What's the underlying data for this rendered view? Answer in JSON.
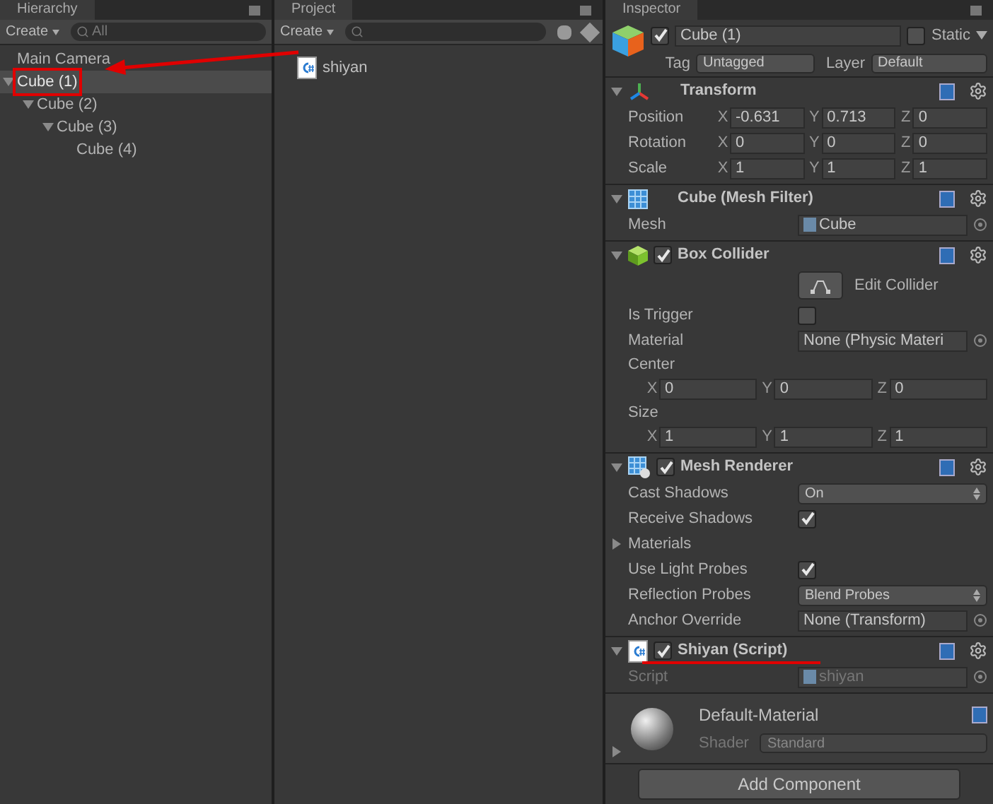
{
  "hierarchy": {
    "tab": "Hierarchy",
    "create": "Create",
    "search_placeholder": "All",
    "items": [
      {
        "label": "Main Camera",
        "selected": false
      },
      {
        "label": "Cube (1)",
        "selected": true,
        "marked": true,
        "expanded": true,
        "children": [
          {
            "label": "Cube (2)",
            "selected": false,
            "expanded": true,
            "children": [
              {
                "label": "Cube (3)",
                "selected": false,
                "expanded": true,
                "children": [
                  {
                    "label": "Cube (4)",
                    "selected": false
                  }
                ]
              }
            ]
          }
        ]
      }
    ]
  },
  "project": {
    "tab": "Project",
    "create": "Create",
    "assets": [
      {
        "name": "shiyan"
      }
    ]
  },
  "inspector": {
    "tab": "Inspector",
    "object": {
      "name": "Cube (1)",
      "active": true,
      "static_label": "Static",
      "static": false,
      "tag_label": "Tag",
      "tag": "Untagged",
      "layer_label": "Layer",
      "layer": "Default"
    },
    "components": [
      {
        "title": "Transform",
        "kind": "transform",
        "rows": [
          {
            "kind": "vector",
            "label": "Position",
            "axes": [
              {
                "axis": "X",
                "value": "-0.631"
              },
              {
                "axis": "Y",
                "value": "0.713"
              },
              {
                "axis": "Z",
                "value": "0"
              }
            ]
          },
          {
            "kind": "vector",
            "label": "Rotation",
            "axes": [
              {
                "axis": "X",
                "value": "0"
              },
              {
                "axis": "Y",
                "value": "0"
              },
              {
                "axis": "Z",
                "value": "0"
              }
            ]
          },
          {
            "kind": "vector",
            "label": "Scale",
            "axes": [
              {
                "axis": "X",
                "value": "1"
              },
              {
                "axis": "Y",
                "value": "1"
              },
              {
                "axis": "Z",
                "value": "1"
              }
            ]
          }
        ]
      },
      {
        "title": "Cube (Mesh Filter)",
        "kind": "mesh_filter",
        "rows": [
          {
            "kind": "object",
            "label": "Mesh",
            "value": "Cube",
            "disabled": false,
            "asset_icon": true
          }
        ]
      },
      {
        "title": "Box Collider",
        "kind": "collider",
        "enabled": true,
        "rows": [
          {
            "kind": "button",
            "label": "Edit Collider"
          },
          {
            "kind": "check",
            "label": "Is Trigger",
            "checked": false
          },
          {
            "kind": "object",
            "label": "Material",
            "value": "None (Physic Materi",
            "disabled": false
          },
          {
            "kind": "vector_block",
            "label": "Center",
            "axes": [
              {
                "axis": "X",
                "value": "0"
              },
              {
                "axis": "Y",
                "value": "0"
              },
              {
                "axis": "Z",
                "value": "0"
              }
            ]
          },
          {
            "kind": "vector_block",
            "label": "Size",
            "axes": [
              {
                "axis": "X",
                "value": "1"
              },
              {
                "axis": "Y",
                "value": "1"
              },
              {
                "axis": "Z",
                "value": "1"
              }
            ]
          }
        ]
      },
      {
        "title": "Mesh Renderer",
        "kind": "renderer",
        "enabled": true,
        "rows": [
          {
            "kind": "dropdown",
            "label": "Cast Shadows",
            "value": "On"
          },
          {
            "kind": "check",
            "label": "Receive Shadows",
            "checked": true
          },
          {
            "kind": "foldout",
            "label": "Materials",
            "expanded": false
          },
          {
            "kind": "check",
            "label": "Use Light Probes",
            "checked": true
          },
          {
            "kind": "dropdown",
            "label": "Reflection Probes",
            "value": "Blend Probes"
          },
          {
            "kind": "object",
            "label": "Anchor Override",
            "value": "None (Transform)",
            "disabled": false
          }
        ]
      },
      {
        "title": "Shiyan (Script)",
        "kind": "script",
        "enabled": true,
        "marked": true,
        "rows": [
          {
            "kind": "object",
            "label": "Script",
            "value": "shiyan",
            "disabled": true,
            "asset_icon": true
          }
        ]
      }
    ],
    "material": {
      "name": "Default-Material",
      "shader_label": "Shader",
      "shader": "Standard",
      "expanded": false
    },
    "add_component": "Add Component"
  }
}
